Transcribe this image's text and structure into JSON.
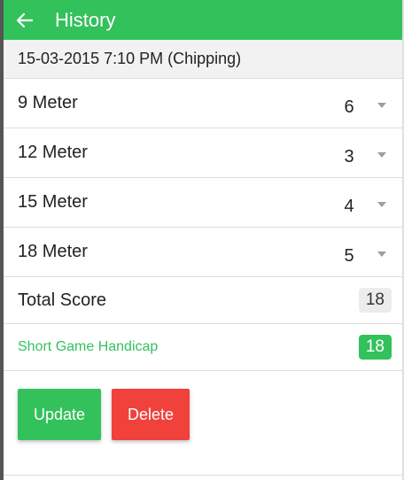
{
  "appbar": {
    "title": "History",
    "back_icon": "arrow-left-icon",
    "color": "#33c15c"
  },
  "session": {
    "label": "15-03-2015 7:10 PM (Chipping)"
  },
  "distances": [
    {
      "label": "9 Meter",
      "value": "6"
    },
    {
      "label": "12 Meter",
      "value": "3"
    },
    {
      "label": "15 Meter",
      "value": "4"
    },
    {
      "label": "18 Meter",
      "value": "5"
    }
  ],
  "total": {
    "label": "Total Score",
    "value": "18"
  },
  "handicap": {
    "label": "Short Game Handicap",
    "value": "18"
  },
  "actions": {
    "update_label": "Update",
    "delete_label": "Delete",
    "update_color": "#33c15c",
    "delete_color": "#f0413b"
  }
}
